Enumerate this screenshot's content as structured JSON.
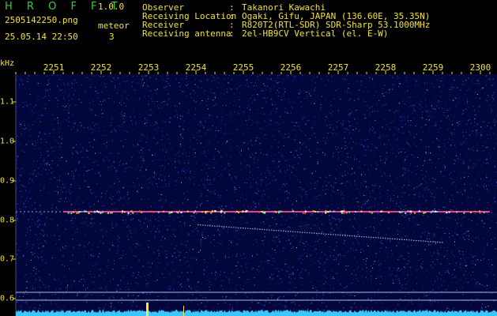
{
  "header": {
    "app_name": "H R O F F T",
    "version": "1.0.0",
    "filename": "2505142250.png",
    "datetime": "25.05.14 22:50",
    "meteor_label": "meteor",
    "meteor_count": "3",
    "info": [
      {
        "key": "Observer",
        "value": "Takanori Kawachi"
      },
      {
        "key": "Receiving Location",
        "value": "Ogaki, Gifu, JAPAN (136.60E, 35.35N)"
      },
      {
        "key": "Receiver",
        "value": "R820T2(RTL-SDR) SDR-Sharp 53.1000MHz"
      },
      {
        "key": "Receiving antenna",
        "value": "2el-HB9CV Vertical (el. E-W)"
      }
    ]
  },
  "axes": {
    "unit": "kHz",
    "time_labels": [
      "2251",
      "2252",
      "2253",
      "2254",
      "2255",
      "2256",
      "2257",
      "2258",
      "2259",
      "2300"
    ],
    "freq_labels": [
      "1.1",
      "1.0",
      "0.9",
      "0.8",
      "0.7",
      "0.6"
    ]
  },
  "colors": {
    "text": "#f2e23a",
    "logo": "#2fd23a",
    "background": "#03063a",
    "carrier": "#e0408a",
    "echo": "#9fd8ff",
    "level": "#38c8ff"
  }
}
